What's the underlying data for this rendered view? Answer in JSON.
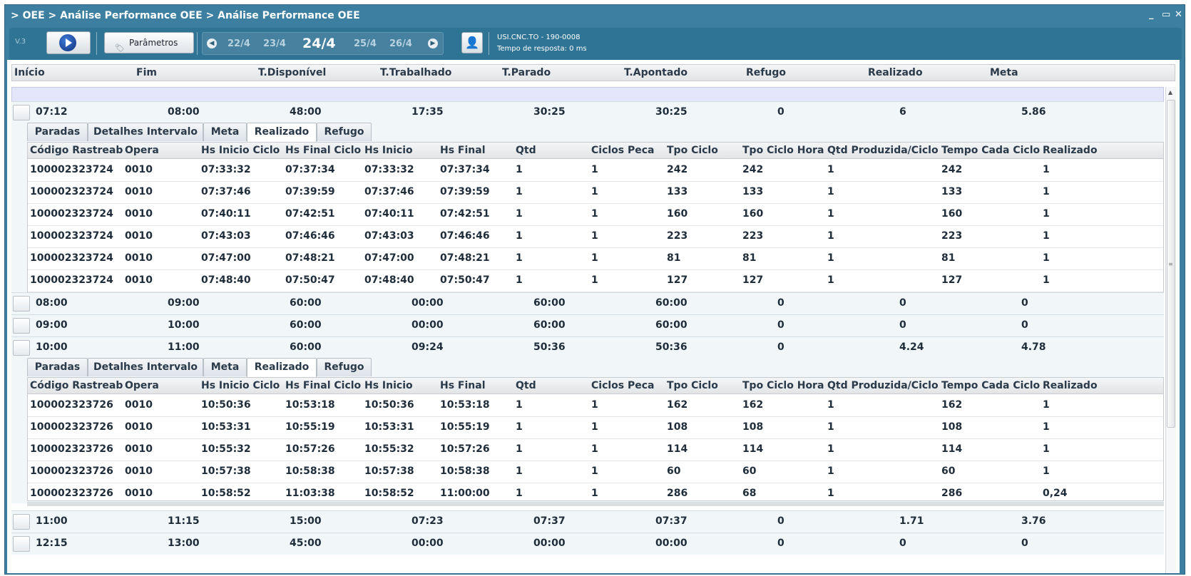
{
  "window": {
    "title": "> OEE > Análise Performance OEE > Análise Performance OEE",
    "minimize": "_",
    "restore": "▭",
    "close": "✕"
  },
  "toolbar": {
    "version": "V.3",
    "params_label": "Parâmetros",
    "dates": [
      "22/4",
      "23/4",
      "24/4",
      "25/4",
      "26/4"
    ],
    "current_date": "24/4",
    "machine": "USI.CNC.TO - 190-0008",
    "response_time": "Tempo de resposta: 0 ms"
  },
  "columns": [
    "Início",
    "Fim",
    "T.Disponível",
    "T.Trabalhado",
    "T.Parado",
    "T.Apontado",
    "Refugo",
    "Realizado",
    "Meta"
  ],
  "tabs": [
    "Paradas",
    "Detalhes Intervalo",
    "Meta",
    "Realizado",
    "Refugo"
  ],
  "active_tab": "Realizado",
  "detail_columns": [
    "Código Rastreab",
    "Opera",
    "Hs Inicio Ciclo",
    "Hs Final Ciclo",
    "Hs Inicio",
    "Hs Final",
    "Qtd",
    "Ciclos Peca",
    "Tpo Ciclo",
    "Tpo Ciclo Hora",
    "Qtd Produzida/Ciclo",
    "Tempo Cada Ciclo",
    "Realizado"
  ],
  "groups": [
    {
      "values": [
        "07:12",
        "08:00",
        "48:00",
        "17:35",
        "30:25",
        "30:25",
        "0",
        "6",
        "5.86"
      ],
      "expanded": true
    },
    {
      "values": [
        "08:00",
        "09:00",
        "60:00",
        "00:00",
        "60:00",
        "60:00",
        "0",
        "0",
        "0"
      ],
      "expanded": false
    },
    {
      "values": [
        "09:00",
        "10:00",
        "60:00",
        "00:00",
        "60:00",
        "60:00",
        "0",
        "0",
        "0"
      ],
      "expanded": false
    },
    {
      "values": [
        "10:00",
        "11:00",
        "60:00",
        "09:24",
        "50:36",
        "50:36",
        "0",
        "4.24",
        "4.78"
      ],
      "expanded": true
    },
    {
      "values": [
        "11:00",
        "11:15",
        "15:00",
        "07:23",
        "07:37",
        "07:37",
        "0",
        "1.71",
        "3.76"
      ],
      "expanded": false
    },
    {
      "values": [
        "12:15",
        "13:00",
        "45:00",
        "00:00",
        "00:00",
        "00:00",
        "0",
        "0",
        "0"
      ],
      "expanded": false
    }
  ],
  "detail1_rows": [
    [
      "100002323724",
      "0010",
      "07:33:32",
      "07:37:34",
      "07:33:32",
      "07:37:34",
      "1",
      "1",
      "242",
      "242",
      "1",
      "242",
      "1"
    ],
    [
      "100002323724",
      "0010",
      "07:37:46",
      "07:39:59",
      "07:37:46",
      "07:39:59",
      "1",
      "1",
      "133",
      "133",
      "1",
      "133",
      "1"
    ],
    [
      "100002323724",
      "0010",
      "07:40:11",
      "07:42:51",
      "07:40:11",
      "07:42:51",
      "1",
      "1",
      "160",
      "160",
      "1",
      "160",
      "1"
    ],
    [
      "100002323724",
      "0010",
      "07:43:03",
      "07:46:46",
      "07:43:03",
      "07:46:46",
      "1",
      "1",
      "223",
      "223",
      "1",
      "223",
      "1"
    ],
    [
      "100002323724",
      "0010",
      "07:47:00",
      "07:48:21",
      "07:47:00",
      "07:48:21",
      "1",
      "1",
      "81",
      "81",
      "1",
      "81",
      "1"
    ],
    [
      "100002323724",
      "0010",
      "07:48:40",
      "07:50:47",
      "07:48:40",
      "07:50:47",
      "1",
      "1",
      "127",
      "127",
      "1",
      "127",
      "1"
    ]
  ],
  "detail2_rows": [
    [
      "100002323726",
      "0010",
      "10:50:36",
      "10:53:18",
      "10:50:36",
      "10:53:18",
      "1",
      "1",
      "162",
      "162",
      "1",
      "162",
      "1"
    ],
    [
      "100002323726",
      "0010",
      "10:53:31",
      "10:55:19",
      "10:53:31",
      "10:55:19",
      "1",
      "1",
      "108",
      "108",
      "1",
      "108",
      "1"
    ],
    [
      "100002323726",
      "0010",
      "10:55:32",
      "10:57:26",
      "10:55:32",
      "10:57:26",
      "1",
      "1",
      "114",
      "114",
      "1",
      "114",
      "1"
    ],
    [
      "100002323726",
      "0010",
      "10:57:38",
      "10:58:38",
      "10:57:38",
      "10:58:38",
      "1",
      "1",
      "60",
      "60",
      "1",
      "60",
      "1"
    ],
    [
      "100002323726",
      "0010",
      "10:58:52",
      "11:03:38",
      "10:58:52",
      "11:00:00",
      "1",
      "1",
      "286",
      "68",
      "1",
      "286",
      "0,24"
    ]
  ]
}
